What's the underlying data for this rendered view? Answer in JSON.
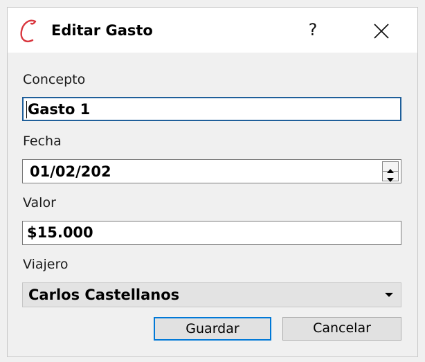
{
  "window": {
    "title": "Editar Gasto",
    "help_label": "?",
    "app_icon": "red-script-c-logo",
    "close_icon": "close-icon"
  },
  "form": {
    "concepto": {
      "label": "Concepto",
      "value": "Gasto 1"
    },
    "fecha": {
      "label": "Fecha",
      "value": "01/02/202"
    },
    "valor": {
      "label": "Valor",
      "value": "$15.000"
    },
    "viajero": {
      "label": "Viajero",
      "value": "Carlos Castellanos"
    }
  },
  "buttons": {
    "save_label": "Guardar",
    "cancel_label": "Cancelar"
  },
  "colors": {
    "focus_border": "#1f5f9a",
    "primary_button_border": "#0078d7",
    "logo_red": "#d9363e"
  }
}
